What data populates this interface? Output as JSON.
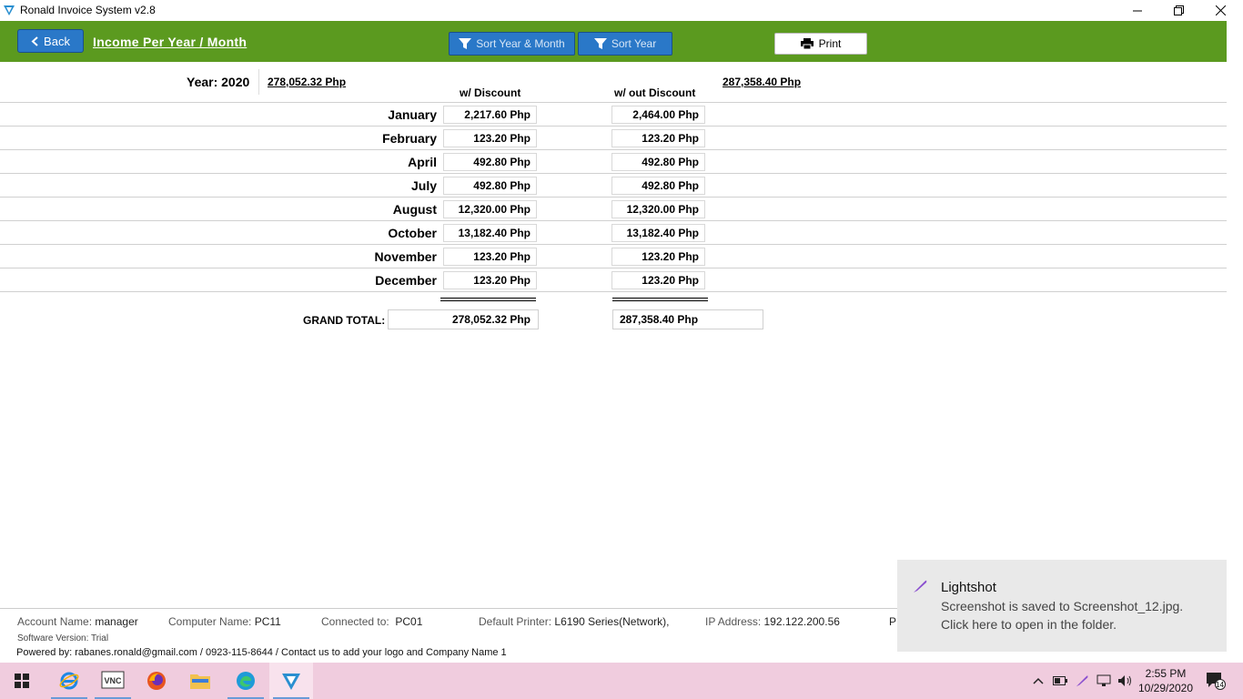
{
  "window": {
    "title": "Ronald Invoice System v2.8"
  },
  "header": {
    "back_label": "Back",
    "page_title": "Income Per Year / Month",
    "sort_year_month_label": "Sort Year & Month",
    "sort_year_label": "Sort Year",
    "print_label": "Print"
  },
  "summary": {
    "year_label": "Year: 2020",
    "total_with_discount": "278,052.32  Php",
    "total_without_discount": "287,358.40  Php",
    "col_with_discount": "w/ Discount",
    "col_without_discount": "w/ out Discount"
  },
  "months": [
    {
      "name": "January",
      "with_discount": "2,217.60 Php",
      "without_discount": "2,464.00 Php"
    },
    {
      "name": "February",
      "with_discount": "123.20 Php",
      "without_discount": "123.20 Php"
    },
    {
      "name": "April",
      "with_discount": "492.80 Php",
      "without_discount": "492.80 Php"
    },
    {
      "name": "July",
      "with_discount": "492.80 Php",
      "without_discount": "492.80 Php"
    },
    {
      "name": "August",
      "with_discount": "12,320.00 Php",
      "without_discount": "12,320.00 Php"
    },
    {
      "name": "October",
      "with_discount": "13,182.40 Php",
      "without_discount": "13,182.40 Php"
    },
    {
      "name": "November",
      "with_discount": "123.20 Php",
      "without_discount": "123.20 Php"
    },
    {
      "name": "December",
      "with_discount": "123.20 Php",
      "without_discount": "123.20 Php"
    }
  ],
  "grand_total": {
    "label": "GRAND TOTAL:",
    "with_discount": "278,052.32  Php",
    "without_discount": "287,358.40  Php"
  },
  "footer": {
    "account_key": "Account Name:",
    "account_val": "manager",
    "computer_key": "Computer Name:",
    "computer_val": "PC11",
    "connected_key": "Connected to:",
    "connected_val": "PC01",
    "printer_key": "Default Printer:",
    "printer_val": "L6190 Series(Network),",
    "ip_key": "IP Address:",
    "ip_val": "192.122.200.56",
    "cut_text": "P",
    "software_version": "Software Version: Trial",
    "powered_by": "Powered by: rabanes.ronald@gmail.com / 0923-115-8644  /  Contact us to add your logo and Company Name 1"
  },
  "toast": {
    "title": "Lightshot",
    "line1": "Screenshot is saved to Screenshot_12.jpg.",
    "line2": "Click here to open in the folder."
  },
  "taskbar": {
    "time": "2:55 PM",
    "date": "10/29/2020",
    "notification_count": "14"
  },
  "colors": {
    "header_green": "#5b9a1f",
    "button_blue": "#2a78c8",
    "taskbar_pink": "#f0ccde"
  }
}
